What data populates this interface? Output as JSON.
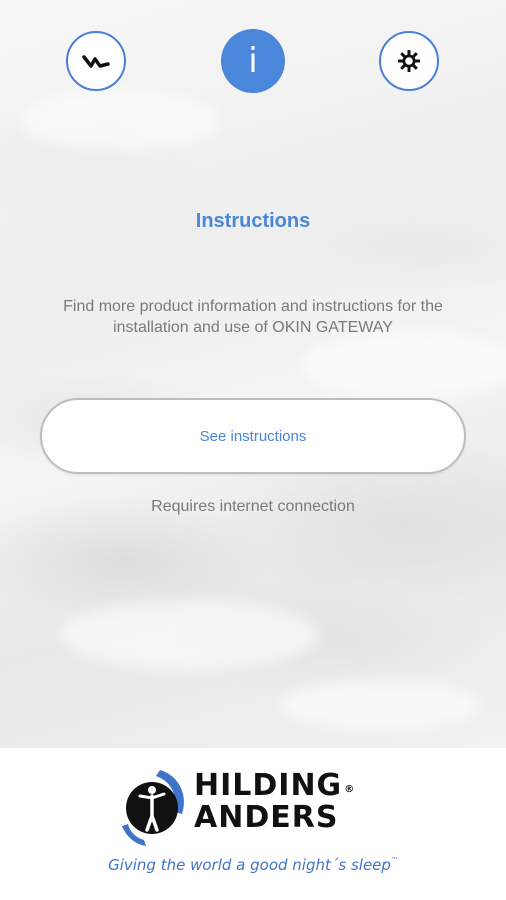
{
  "nav": {
    "remote_icon": "wave-remote-icon",
    "info_icon": "info-icon",
    "info_glyph": "i",
    "settings_icon": "gear-icon",
    "active_tab": "info"
  },
  "main": {
    "title": "Instructions",
    "description_line1": "Find more product information and instructions for the",
    "description_line2": "installation and use of OKIN GATEWAY",
    "button_label": "See instructions",
    "requires_text": "Requires internet connection"
  },
  "footer": {
    "brand_line1": "HILDING",
    "brand_line2": "ANDERS",
    "registered_mark": "®",
    "tagline": "Giving the world a good night´s sleep",
    "trademark": "™"
  },
  "colors": {
    "accent": "#4a86d9",
    "text_gray": "#7a7a7a",
    "tagline_blue": "#3f74c8",
    "logo_blue": "#3f74c8",
    "logo_black": "#111111"
  }
}
